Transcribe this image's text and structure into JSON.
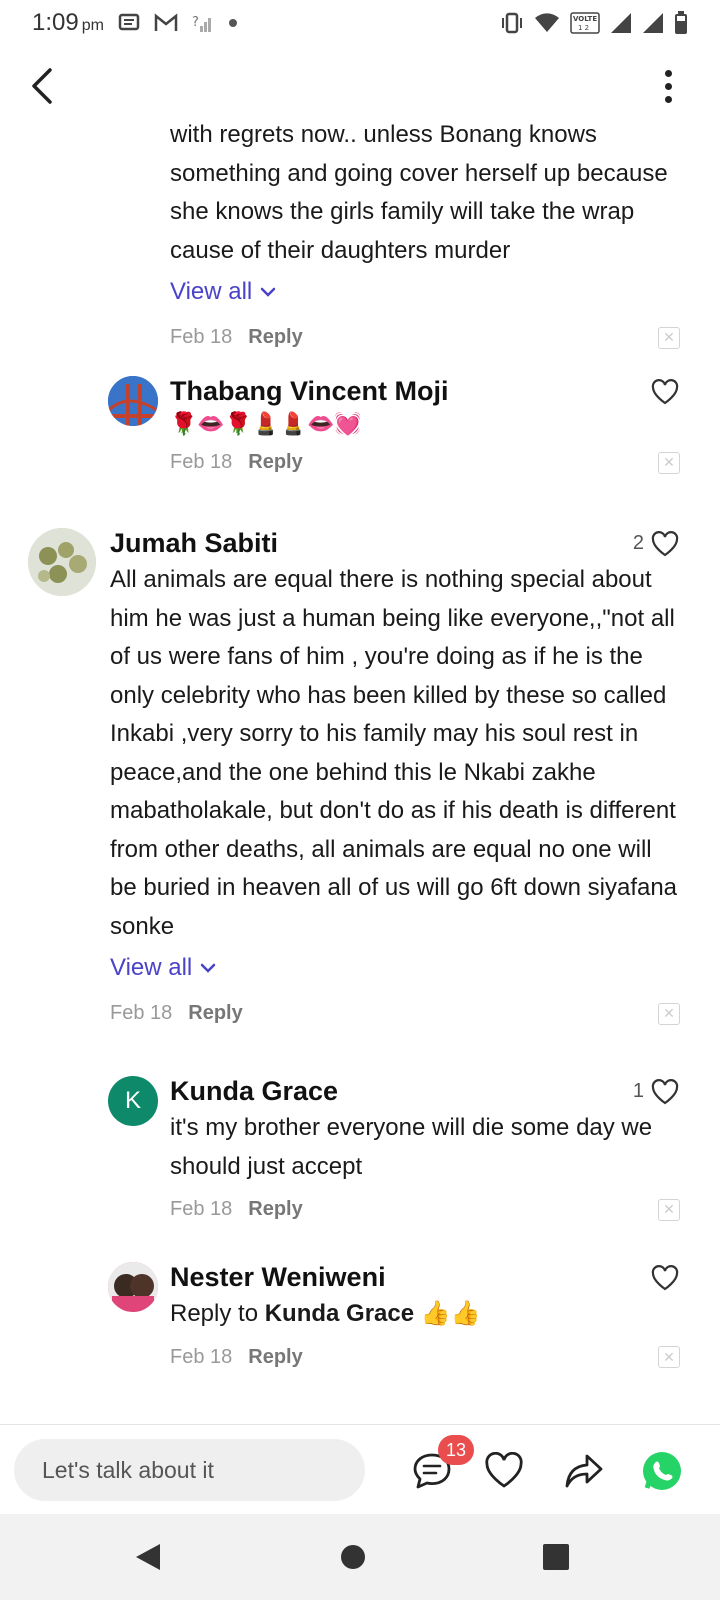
{
  "status_bar": {
    "time": "1:09",
    "ampm": "pm",
    "volte_label": "VOLTE",
    "sim_label": "1 2"
  },
  "app_bar": {
    "back_icon": "chevron-left-icon",
    "more_icon": "more-vertical-icon"
  },
  "comments": [
    {
      "text": "with regrets now.. unless Bonang knows something and going cover herself up because she knows the girls family will take the wrap cause of their daughters murder",
      "view_all": "View all",
      "date": "Feb 18",
      "reply": "Reply"
    },
    {
      "name": "Thabang Vincent Moji",
      "text": "🌹👄🌹💄💄👄💓",
      "date": "Feb 18",
      "reply": "Reply",
      "likes": ""
    },
    {
      "name": "Jumah Sabiti",
      "likes": "2",
      "text": "All animals are equal  there is nothing special about him he was just a human being like everyone,,\"not all of us were  fans  of him , you're doing as if he is the only celebrity who has been killed by these so called Inkabi ,very  sorry to his family may his soul  rest in peace,and the one behind this le Nkabi zakhe mabatholakale, but don't  do as  if  his death  is  different from other deaths,  all animals are  equal  no one will be buried in heaven all of us will go 6ft down  siyafana sonke",
      "view_all": "View all",
      "date": "Feb 18",
      "reply": "Reply"
    },
    {
      "name": "Kunda Grace",
      "avatar_letter": "K",
      "likes": "1",
      "text": "it's my brother everyone will die some day we should just accept",
      "date": "Feb 18",
      "reply": "Reply"
    },
    {
      "name": "Nester Weniweni",
      "reply_prefix": "Reply to ",
      "reply_to": "Kunda Grace",
      "reply_emojis": "👍👍",
      "date": "Feb 18",
      "reply": "Reply",
      "likes": ""
    }
  ],
  "bottom_bar": {
    "input_placeholder": "Let's talk about it",
    "comment_count": "13"
  },
  "colors": {
    "link": "#4a42c8",
    "badge": "#e94d4d",
    "whatsapp": "#25d366",
    "kunda_avatar": "#0e8a6a"
  }
}
